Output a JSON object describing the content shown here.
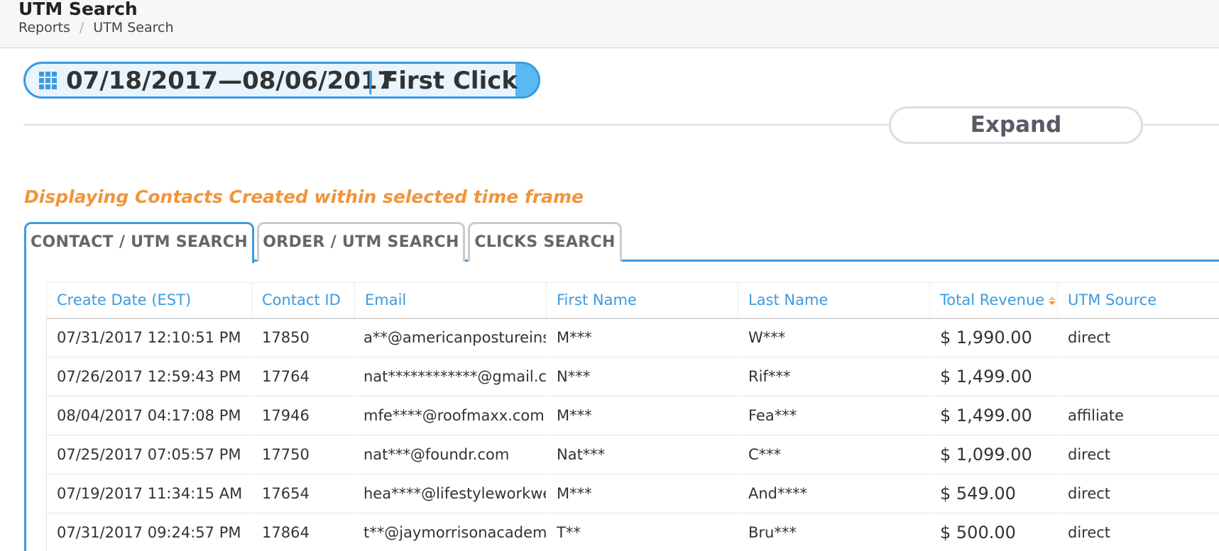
{
  "header": {
    "title": "UTM Search",
    "breadcrumb": [
      "Reports",
      "UTM Search"
    ],
    "breadcrumb_separator": "/"
  },
  "date_filter": {
    "icon": "calendar-grid-icon",
    "range": "07/18/2017—08/06/2017",
    "divider": "|",
    "attribution": "First Click"
  },
  "expand_button": {
    "label": "Expand"
  },
  "notice": "Displaying Contacts Created within selected time frame",
  "tabs": [
    {
      "label": "CONTACT / UTM SEARCH",
      "active": true
    },
    {
      "label": "ORDER / UTM SEARCH",
      "active": false
    },
    {
      "label": "CLICKS SEARCH",
      "active": false
    }
  ],
  "table": {
    "columns": [
      "Create Date (EST)",
      "Contact ID",
      "Email",
      "First Name",
      "Last Name",
      "Total Revenue",
      "UTM Source"
    ],
    "sorted_column": "Total Revenue",
    "sort_direction": "descending",
    "rows": [
      [
        "07/31/2017 12:10:51 PM",
        "17850",
        "a**@americanpostureinstitute.com",
        "M***",
        "W***",
        "$ 1,990.00",
        "direct"
      ],
      [
        "07/26/2017 12:59:43 PM",
        "17764",
        "nat************@gmail.com",
        "N***",
        "Rif***",
        "$ 1,499.00",
        ""
      ],
      [
        "08/04/2017 04:17:08 PM",
        "17946",
        "mfe****@roofmaxx.com",
        "M***",
        "Fea***",
        "$ 1,499.00",
        "affiliate"
      ],
      [
        "07/25/2017 07:05:57 PM",
        "17750",
        "nat***@foundr.com",
        "Nat***",
        "C***",
        "$ 1,099.00",
        "direct"
      ],
      [
        "07/19/2017 11:34:15 AM",
        "17654",
        "hea****@lifestyleworkweek.com",
        "M***",
        "And****",
        "$ 549.00",
        "direct"
      ],
      [
        "07/31/2017 09:24:57 PM",
        "17864",
        "t**@jaymorrisonacademy.com",
        "T**",
        "Bru***",
        "$ 500.00",
        "direct"
      ]
    ]
  },
  "colors": {
    "accent": "#3c9be0",
    "pill_fill": "#5ab8f5",
    "notice": "#f0953c",
    "sort_indicator": "#f0953c"
  }
}
